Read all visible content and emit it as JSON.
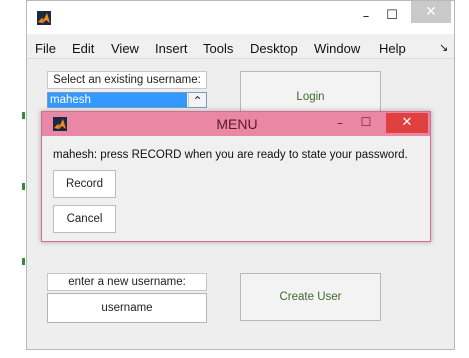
{
  "window": {
    "minimize_glyph": "–",
    "maximize_glyph": "☐",
    "close_glyph": "✕"
  },
  "menu": {
    "items": [
      "File",
      "Edit",
      "View",
      "Insert",
      "Tools",
      "Desktop",
      "Window",
      "Help"
    ],
    "overflow_glyph": "↘"
  },
  "existing_user": {
    "label": "Select an existing username:",
    "selected_value": "mahesh",
    "scroll_glyph": "⌃"
  },
  "login_button": "Login",
  "new_user": {
    "label": "enter a new username:",
    "field_value": "username"
  },
  "create_user_button": "Create User",
  "dialog": {
    "title": "MENU",
    "minimize_glyph": "–",
    "maximize_glyph": "☐",
    "close_glyph": "✕",
    "message": "mahesh: press RECORD when you are ready to state your password.",
    "record_button": "Record",
    "cancel_button": "Cancel"
  },
  "colors": {
    "dialog_titlebar": "#ea87a5",
    "dialog_close": "#e0413f",
    "selection": "#3399ff",
    "button_text": "#3b6b2a"
  }
}
